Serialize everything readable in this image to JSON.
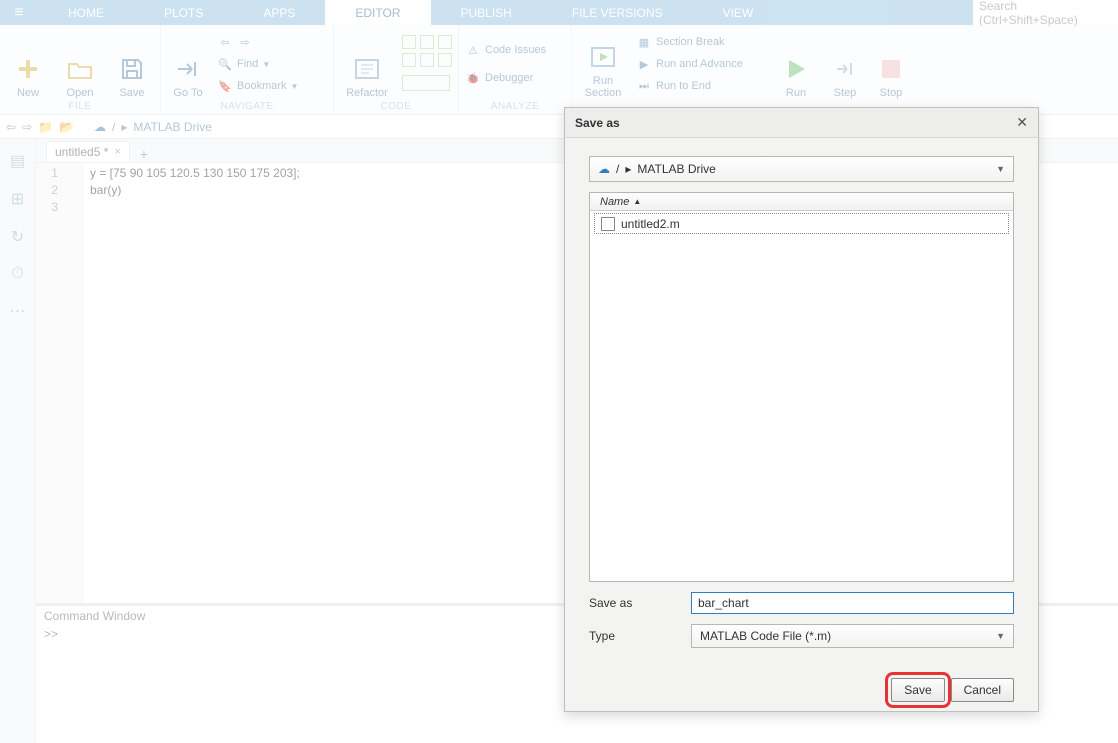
{
  "search": {
    "placeholder": "Search (Ctrl+Shift+Space)"
  },
  "tabs": {
    "home": "HOME",
    "plots": "PLOTS",
    "apps": "APPS",
    "editor": "EDITOR",
    "publish": "PUBLISH",
    "file_versions": "FILE VERSIONS",
    "view": "VIEW"
  },
  "tool": {
    "new": "New",
    "open": "Open",
    "save": "Save",
    "goto": "Go To",
    "find": "Find",
    "bookmark": "Bookmark",
    "refactor": "Refactor",
    "code_issues": "Code Issues",
    "debugger": "Debugger",
    "run_section": "Run\nSection",
    "section_break": "Section Break",
    "run_and_advance": "Run and Advance",
    "run_to_end": "Run to End",
    "run": "Run",
    "step": "Step",
    "stop": "Stop"
  },
  "groups": {
    "file": "FILE",
    "navigate": "NAVIGATE",
    "code": "CODE",
    "analyze": "ANALYZE"
  },
  "pathbar": {
    "root": "/",
    "drive": "MATLAB Drive",
    "sep": "▸"
  },
  "editor": {
    "tab_name": "untitled5 *",
    "line1": "y = [75 90 105 120.5 130 150 175 203];",
    "line2": "bar(y)",
    "ln1": "1",
    "ln2": "2",
    "ln3": "3"
  },
  "cmdwin": {
    "title": "Command Window",
    "prompt": ">> "
  },
  "modal": {
    "title": "Save as",
    "path_root": "/",
    "path_drive": "MATLAB Drive",
    "col_name": "Name",
    "file0": "untitled2.m",
    "label_saveas": "Save as",
    "filename_value": "bar_chart",
    "label_type": "Type",
    "type_value": "MATLAB Code File (*.m)",
    "btn_save": "Save",
    "btn_cancel": "Cancel"
  }
}
